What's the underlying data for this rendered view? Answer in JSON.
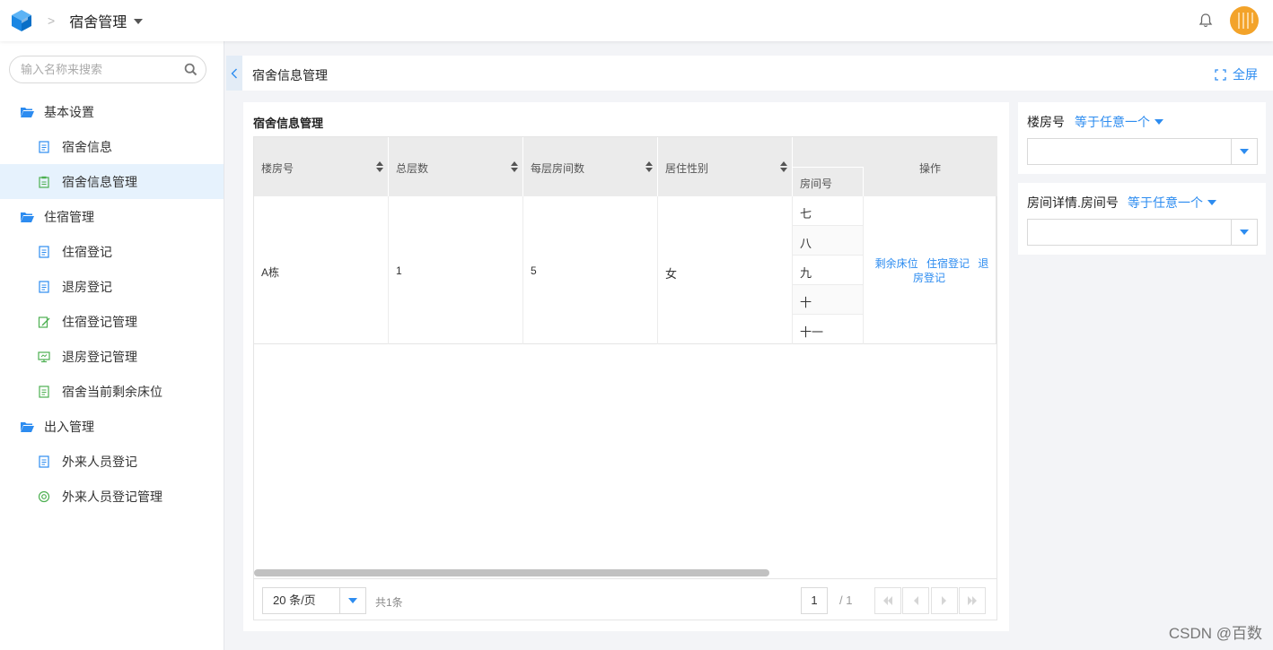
{
  "app": {
    "title": "宿舍管理",
    "separator": ">"
  },
  "colors": {
    "accent": "#2d8cf0",
    "active_bg": "#e6f2fd",
    "avatar": "#f3a32a"
  },
  "sidebar": {
    "search_placeholder": "输入名称来搜索",
    "items": [
      {
        "label": "基本设置",
        "type": "group",
        "icon": "folder-open-icon"
      },
      {
        "label": "宿舍信息",
        "type": "sub",
        "icon": "document-icon"
      },
      {
        "label": "宿舍信息管理",
        "type": "sub",
        "icon": "clipboard-icon",
        "active": true
      },
      {
        "label": "住宿管理",
        "type": "group",
        "icon": "folder-open-icon"
      },
      {
        "label": "住宿登记",
        "type": "sub",
        "icon": "document-icon"
      },
      {
        "label": "退房登记",
        "type": "sub",
        "icon": "document-icon"
      },
      {
        "label": "住宿登记管理",
        "type": "sub",
        "icon": "edit-icon"
      },
      {
        "label": "退房登记管理",
        "type": "sub",
        "icon": "monitor-icon"
      },
      {
        "label": "宿舍当前剩余床位",
        "type": "sub",
        "icon": "document-green-icon"
      },
      {
        "label": "出入管理",
        "type": "group",
        "icon": "folder-open-icon"
      },
      {
        "label": "外来人员登记",
        "type": "sub",
        "icon": "document-icon"
      },
      {
        "label": "外来人员登记管理",
        "type": "sub",
        "icon": "target-icon"
      }
    ]
  },
  "page": {
    "title": "宿舍信息管理",
    "fullscreen_label": "全屏"
  },
  "card": {
    "title": "宿舍信息管理"
  },
  "table": {
    "columns": [
      "楼房号",
      "总层数",
      "每层房间数",
      "居住性别",
      "房间号",
      "操作"
    ],
    "rows": [
      {
        "building": "A栋",
        "floors": "1",
        "rooms_per_floor": "5",
        "gender": "女",
        "room_numbers": [
          "七",
          "八",
          "九",
          "十",
          "十一"
        ],
        "actions": [
          "剩余床位",
          "住宿登记",
          "退房登记"
        ]
      }
    ]
  },
  "pager": {
    "page_size": "20 条/页",
    "total": "共1条",
    "current_page": "1",
    "of_pages": "/ 1"
  },
  "filters": [
    {
      "label": "楼房号",
      "operator": "等于任意一个"
    },
    {
      "label": "房间详情.房间号",
      "operator": "等于任意一个"
    }
  ],
  "watermark": "CSDN @百数"
}
